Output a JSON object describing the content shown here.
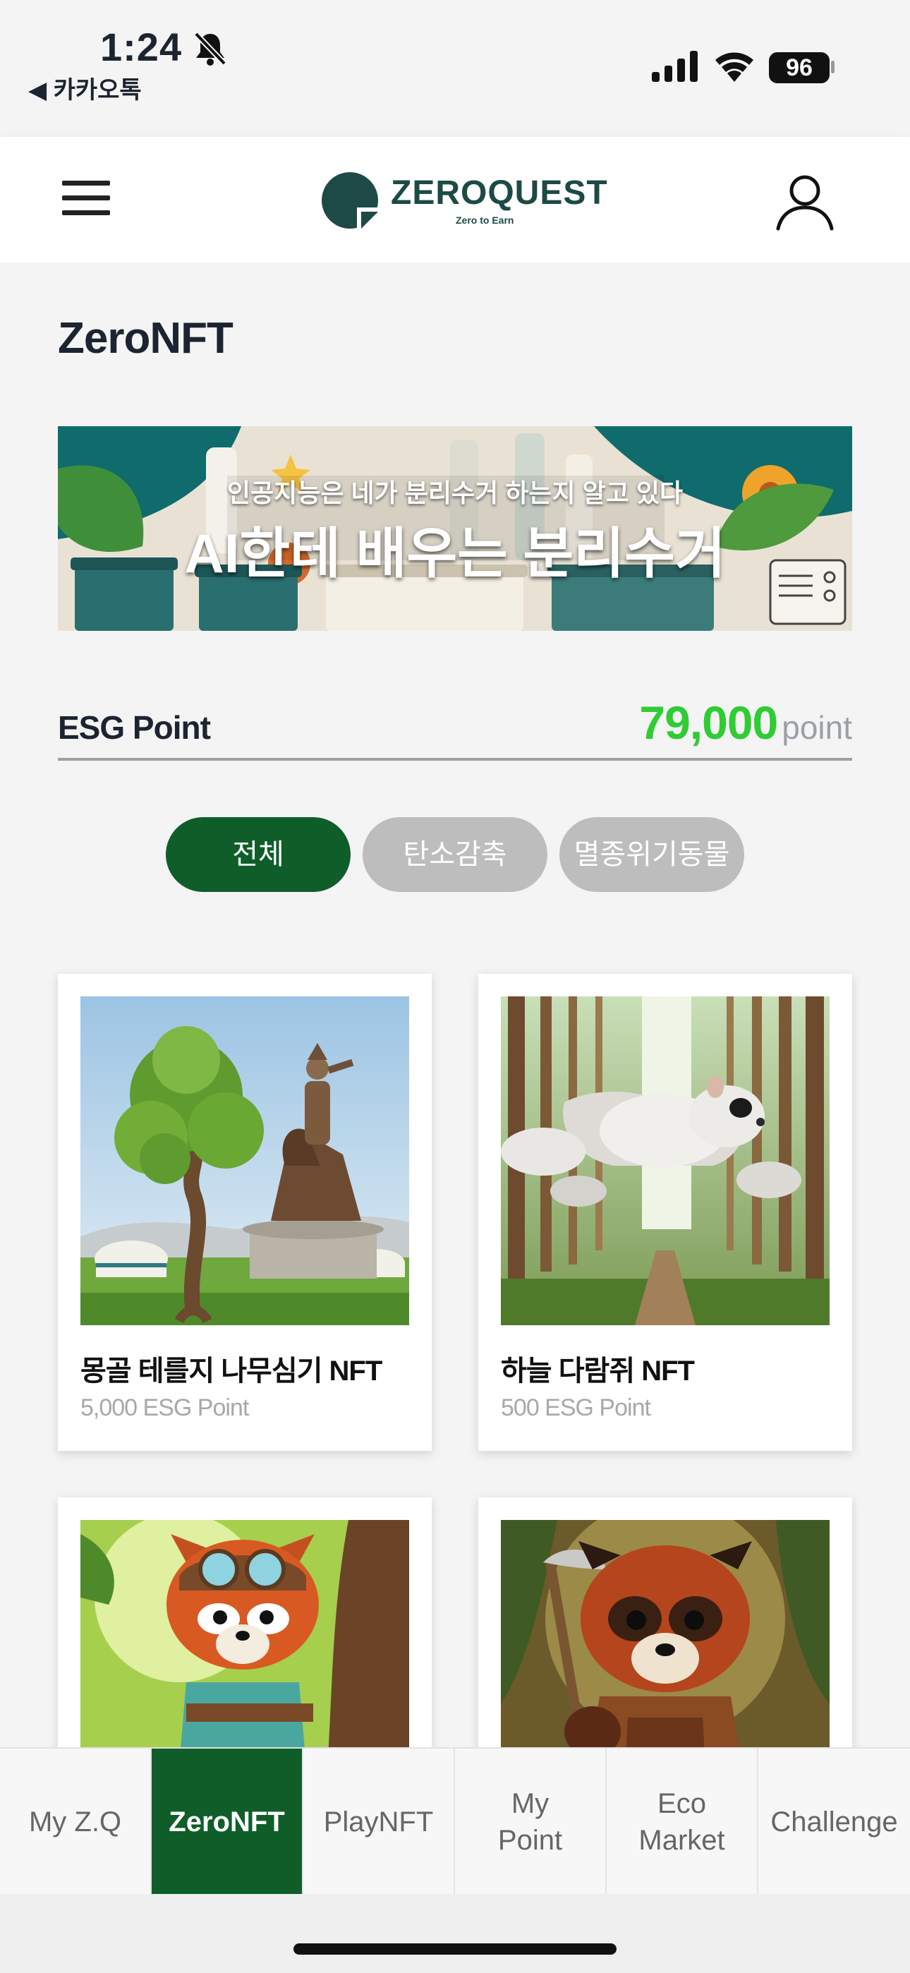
{
  "status_bar": {
    "time": "1:24",
    "back_app": "◀ 카카오톡",
    "battery": "96"
  },
  "header": {
    "logo_text": "ZEROQUEST",
    "logo_tagline": "Zero to Earn"
  },
  "page": {
    "title": "ZeroNFT"
  },
  "banner": {
    "subtitle": "인공지능은 네가 분리수거 하는지 알고 있다",
    "title": "AI한테 배우는 분리수거"
  },
  "esg": {
    "label": "ESG Point",
    "value": "79,000",
    "unit": "point"
  },
  "filters": [
    {
      "label": "전체",
      "active": true
    },
    {
      "label": "탄소감축",
      "active": false
    },
    {
      "label": "멸종위기동물",
      "active": false
    }
  ],
  "nft_cards": [
    {
      "name": "몽골 테를지 나무심기 NFT",
      "price": "5,000 ESG Point"
    },
    {
      "name": "하늘 다람쥐 NFT",
      "price": "500 ESG Point"
    },
    {
      "name": "",
      "price": ""
    },
    {
      "name": "",
      "price": ""
    }
  ],
  "tabbar": [
    {
      "label": "My Z.Q",
      "active": false
    },
    {
      "label": "ZeroNFT",
      "active": true
    },
    {
      "label": "PlayNFT",
      "active": false
    },
    {
      "label": "My\nPoint",
      "active": false
    },
    {
      "label": "Eco\nMarket",
      "active": false
    },
    {
      "label": "Challenge",
      "active": false
    }
  ],
  "colors": {
    "brand_green": "#0f5e2a",
    "point_green": "#2fcc33",
    "logo_teal": "#1d4a46",
    "chip_inactive": "#bdbdbd"
  },
  "icons": [
    "bell-slash-icon",
    "cellular-signal-icon",
    "wifi-icon",
    "battery-icon",
    "hamburger-menu-icon",
    "user-profile-icon"
  ]
}
